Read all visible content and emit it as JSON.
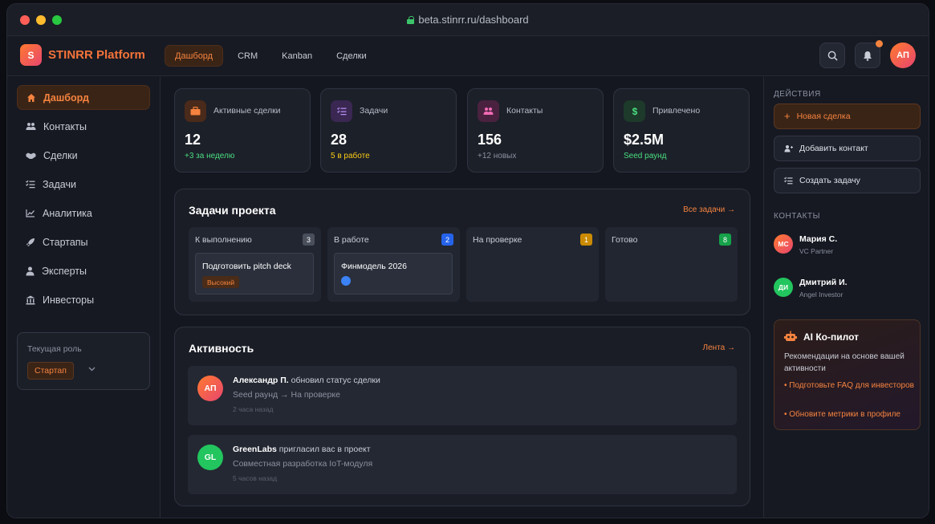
{
  "browser": {
    "url": "beta.stinrr.ru/dashboard"
  },
  "brand": {
    "logo_letter": "S",
    "name": "STINRR Platform"
  },
  "topnav": {
    "tabs": [
      "Дашборд",
      "CRM",
      "Kanban",
      "Сделки"
    ],
    "avatar_initials": "АП"
  },
  "sidebar": {
    "items": [
      {
        "label": "Дашборд",
        "icon": "home-icon"
      },
      {
        "label": "Контакты",
        "icon": "users-icon"
      },
      {
        "label": "Сделки",
        "icon": "handshake-icon"
      },
      {
        "label": "Задачи",
        "icon": "checklist-icon"
      },
      {
        "label": "Аналитика",
        "icon": "chart-icon"
      },
      {
        "label": "Стартапы",
        "icon": "rocket-icon"
      },
      {
        "label": "Эксперты",
        "icon": "user-icon"
      },
      {
        "label": "Инвесторы",
        "icon": "bank-icon"
      }
    ],
    "role_label": "Текущая роль",
    "role_value": "Стартап"
  },
  "stats": [
    {
      "label": "Активные сделки",
      "value": "12",
      "sub": "+3 за неделю",
      "sub_color": "#4ade80",
      "icon": "briefcase-icon",
      "icon_bg": "#4a2a1a",
      "icon_color": "#f5833f"
    },
    {
      "label": "Задачи",
      "value": "28",
      "sub": "5 в работе",
      "sub_color": "#facc15",
      "icon": "checklist-icon",
      "icon_bg": "#3a2752",
      "icon_color": "#b48cf2"
    },
    {
      "label": "Контакты",
      "value": "156",
      "sub": "+12 новых",
      "sub_color": "#8b90a0",
      "icon": "users-icon",
      "icon_bg": "#4a2240",
      "icon_color": "#f26bb4"
    },
    {
      "label": "Привлечено",
      "value": "$2.5M",
      "sub": "Seed раунд",
      "sub_color": "#4ade80",
      "icon": "dollar-icon",
      "icon_bg": "#1d3a2a",
      "icon_color": "#4ade80"
    }
  ],
  "tasks_panel": {
    "title": "Задачи проекта",
    "link": "Все задачи →",
    "columns": [
      {
        "title": "К выполнению",
        "count": "3",
        "count_color": "#4a4f5c",
        "cards": [
          {
            "title": "Подготовить pitch deck",
            "tag": "Высокий"
          }
        ]
      },
      {
        "title": "В работе",
        "count": "2",
        "count_color": "#2563eb",
        "cards": [
          {
            "title": "Финмодель 2026"
          }
        ]
      },
      {
        "title": "На проверке",
        "count": "1",
        "count_color": "#ca8a04",
        "cards": []
      },
      {
        "title": "Готово",
        "count": "8",
        "count_color": "#16a34a",
        "cards": []
      }
    ]
  },
  "activity_panel": {
    "title": "Активность",
    "link": "Лента →",
    "items": [
      {
        "initials": "АП",
        "avatar_color": "#f26b2f",
        "name": "Александр П.",
        "action": " обновил статус сделки",
        "detail": "Seed раунд → На проверке",
        "time": "2 часа назад"
      },
      {
        "initials": "GL",
        "avatar_color": "#22c55e",
        "name": "GreenLabs",
        "action": " пригласил вас в проект",
        "detail": "Совместная разработка IoT-модуля",
        "time": "5 часов назад"
      }
    ]
  },
  "actions": {
    "heading": "ДЕЙСТВИЯ",
    "new_deal": "Новая сделка",
    "add_contact": "Добавить контакт",
    "create_task": "Создать задачу"
  },
  "contacts": {
    "heading": "КОНТАКТЫ",
    "items": [
      {
        "initials": "МС",
        "name": "Мария С.",
        "role": "VC Partner",
        "avatar_color": "#e8456f"
      },
      {
        "initials": "ДИ",
        "name": "Дмитрий И.",
        "role": "Angel Investor",
        "avatar_color": "#22c55e"
      }
    ]
  },
  "ai": {
    "title": "AI Ко-пилот",
    "description": "Рекомендации на основе вашей активности",
    "recommendations": [
      "• Подготовьте FAQ для инвесторов",
      "• Обновите метрики в профиле"
    ]
  }
}
